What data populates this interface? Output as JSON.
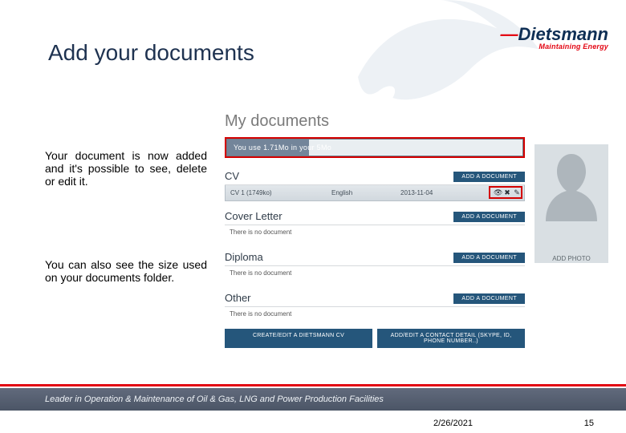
{
  "slide": {
    "title": "Add your documents",
    "instruction1": "Your document is now added and it's possible to see, delete or edit it.",
    "instruction2": "You can also see the size used on your documents folder.",
    "footer": "Leader in Operation & Maintenance of Oil & Gas, LNG and Power Production Facilities",
    "date": "2/26/2021",
    "page": "15"
  },
  "logo": {
    "name": "Dietsmann",
    "tagline": "Maintaining Energy"
  },
  "panel": {
    "title": "My documents",
    "usage": "You use 1.71Mo in your 5Mo",
    "add_label": "ADD A DOCUMENT",
    "no_doc": "There is no document",
    "avatar_caption": "ADD PHOTO",
    "actions": {
      "create": "CREATE/EDIT A DIETSMANN CV",
      "contact": "ADD/EDIT A CONTACT DETAIL (SKYPE, ID, PHONE NUMBER..)"
    },
    "sections": {
      "cv": "CV",
      "cover": "Cover Letter",
      "diploma": "Diploma",
      "other": "Other"
    },
    "cv_row": {
      "name": "CV 1 (1749ko)",
      "lang": "English",
      "date": "2013-11-04"
    }
  }
}
